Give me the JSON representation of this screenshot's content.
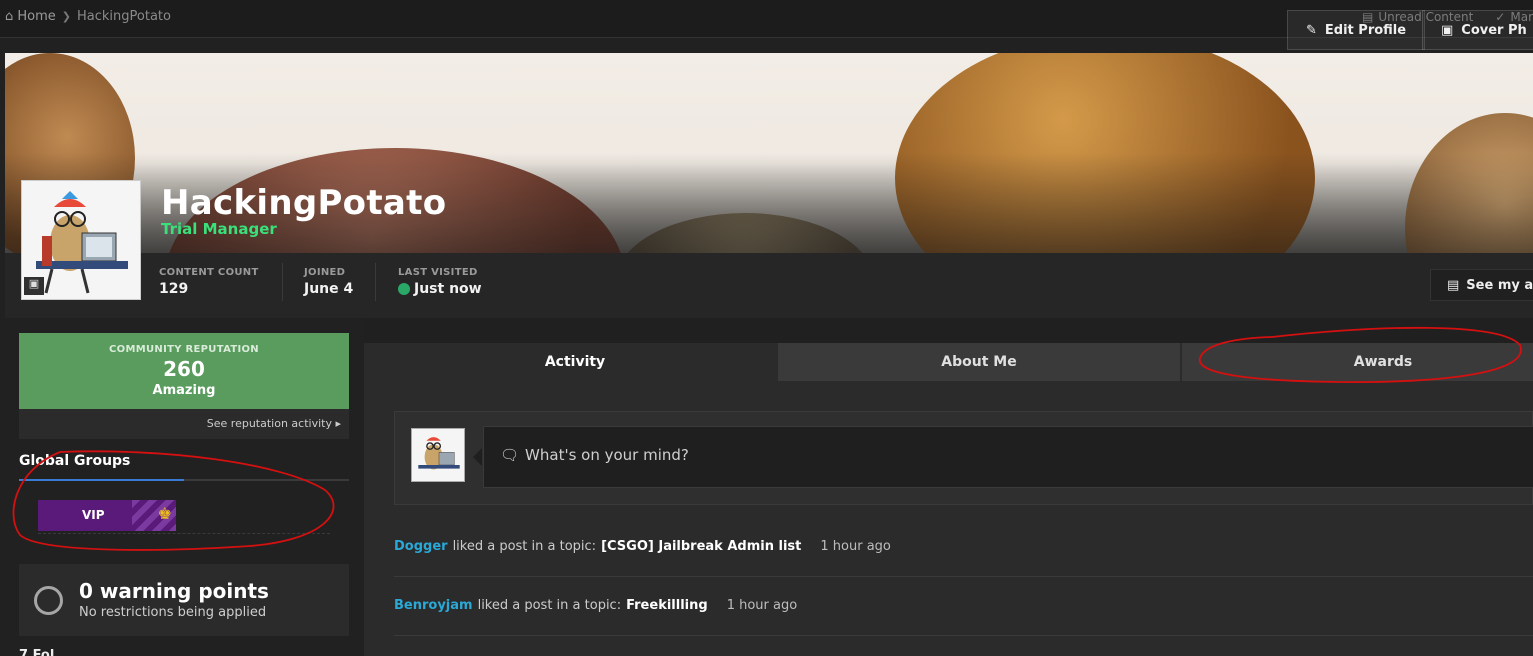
{
  "breadcrumb": {
    "home": "Home",
    "current": "HackingPotato"
  },
  "toplinks": {
    "unread": "Unread Content",
    "mark": "Mar"
  },
  "cover": {
    "edit_profile": "Edit Profile",
    "cover_photo": "Cover Ph"
  },
  "profile": {
    "username": "HackingPotato",
    "title": "Trial Manager",
    "stats": [
      {
        "label": "CONTENT COUNT",
        "value": "129"
      },
      {
        "label": "JOINED",
        "value": "June 4"
      },
      {
        "label": "LAST VISITED",
        "value": "Just now"
      }
    ],
    "see_activity": "See my act"
  },
  "reputation": {
    "label": "COMMUNITY REPUTATION",
    "value": "260",
    "word": "Amazing",
    "link": "See reputation activity"
  },
  "groups": {
    "title": "Global Groups",
    "badge": "VIP"
  },
  "warnings": {
    "title": "0 warning points",
    "subtitle": "No restrictions being applied"
  },
  "tabs": [
    "Activity",
    "About Me",
    "Awards"
  ],
  "status": {
    "placeholder": "What's on your mind?"
  },
  "activity": [
    {
      "user": "Dogger",
      "action": "liked a post in a topic:",
      "topic": "[CSGO] Jailbreak Admin list",
      "time": "1 hour ago"
    },
    {
      "user": "Benroyjam",
      "action": "liked a post in a topic:",
      "topic": "Freekillling",
      "time": "1 hour ago"
    }
  ],
  "colors": {
    "accent_green": "#3ae07a",
    "rep_green": "#5a9b5e",
    "link_blue": "#2aa8d6",
    "vip_purple": "#5a1a7a"
  },
  "bottom_left": "7 Fol..."
}
